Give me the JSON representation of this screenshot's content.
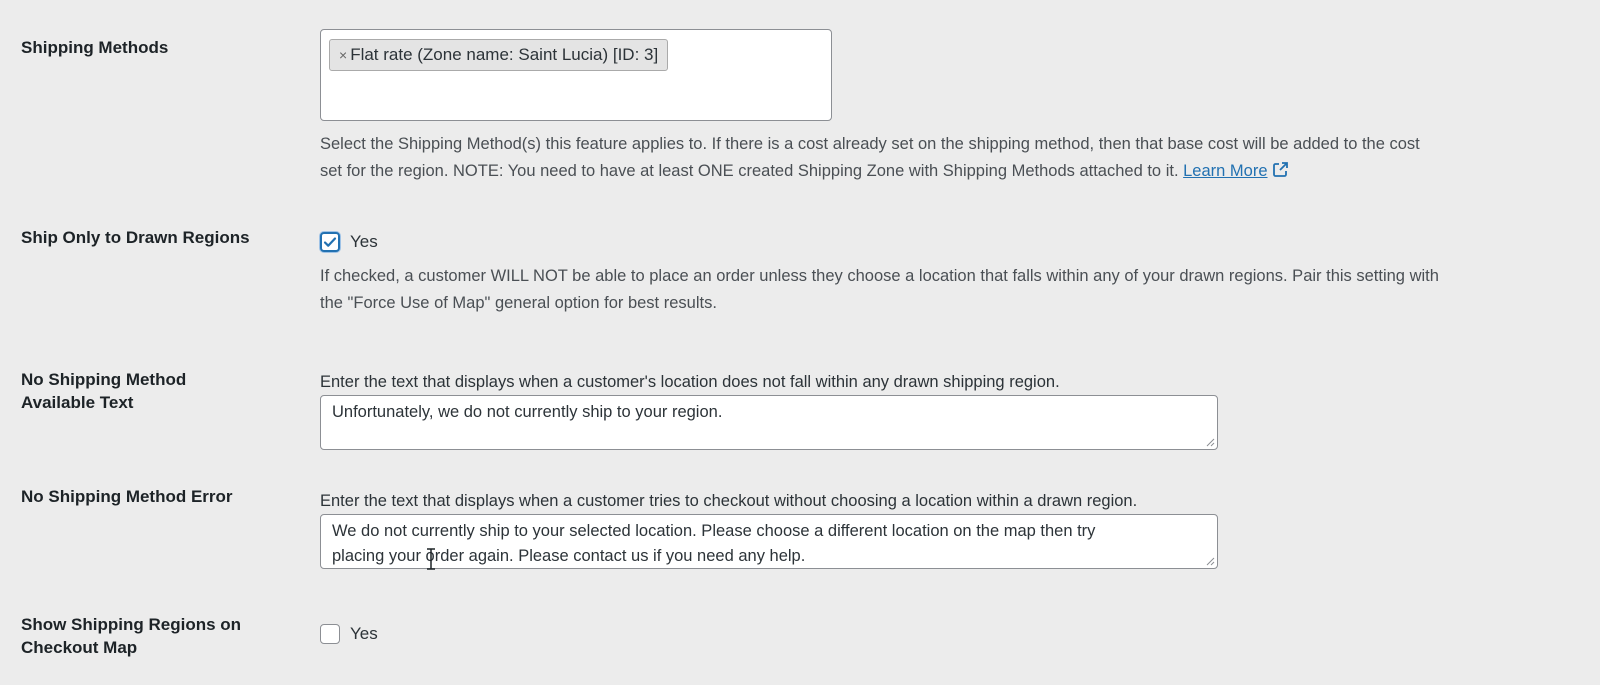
{
  "shipping_methods": {
    "label": "Shipping Methods",
    "selected_chip": "Flat rate (Zone name: Saint Lucia) [ID: 3]",
    "chip_remove": "×",
    "description_line1": "Select the Shipping Method(s) this feature applies to. If there is a cost already set on the shipping method, then that base cost will be added to the cost",
    "description_line2": "set for the region. NOTE: You need to have at least ONE created Shipping Zone with Shipping Methods attached to it.",
    "learn_more": "Learn More"
  },
  "ship_only_drawn": {
    "label": "Ship Only to Drawn Regions",
    "checked": true,
    "option_label": "Yes",
    "description_line1": "If checked, a customer WILL NOT be able to place an order unless they choose a location that falls within any of your drawn regions. Pair this setting with",
    "description_line2": "the \"Force Use of Map\" general option for best results."
  },
  "no_method_text": {
    "label_line1": "No Shipping Method",
    "label_line2": "Available Text",
    "description": "Enter the text that displays when a customer's location does not fall within any drawn shipping region.",
    "value": "Unfortunately, we do not currently ship to your region."
  },
  "no_method_error": {
    "label": "No Shipping Method Error",
    "description": "Enter the text that displays when a customer tries to checkout without choosing a location within a drawn region.",
    "value_line1": "We do not currently ship to your selected location. Please choose a different location on the map then try",
    "value_line2": "placing your order again. Please contact us if you need any help."
  },
  "show_regions": {
    "label_line1": "Show Shipping Regions on",
    "label_line2": "Checkout Map",
    "checked": false,
    "option_label": "Yes"
  },
  "colors": {
    "background": "#ececec",
    "link": "#2271b1",
    "checkbox_accent": "#2271b1"
  }
}
